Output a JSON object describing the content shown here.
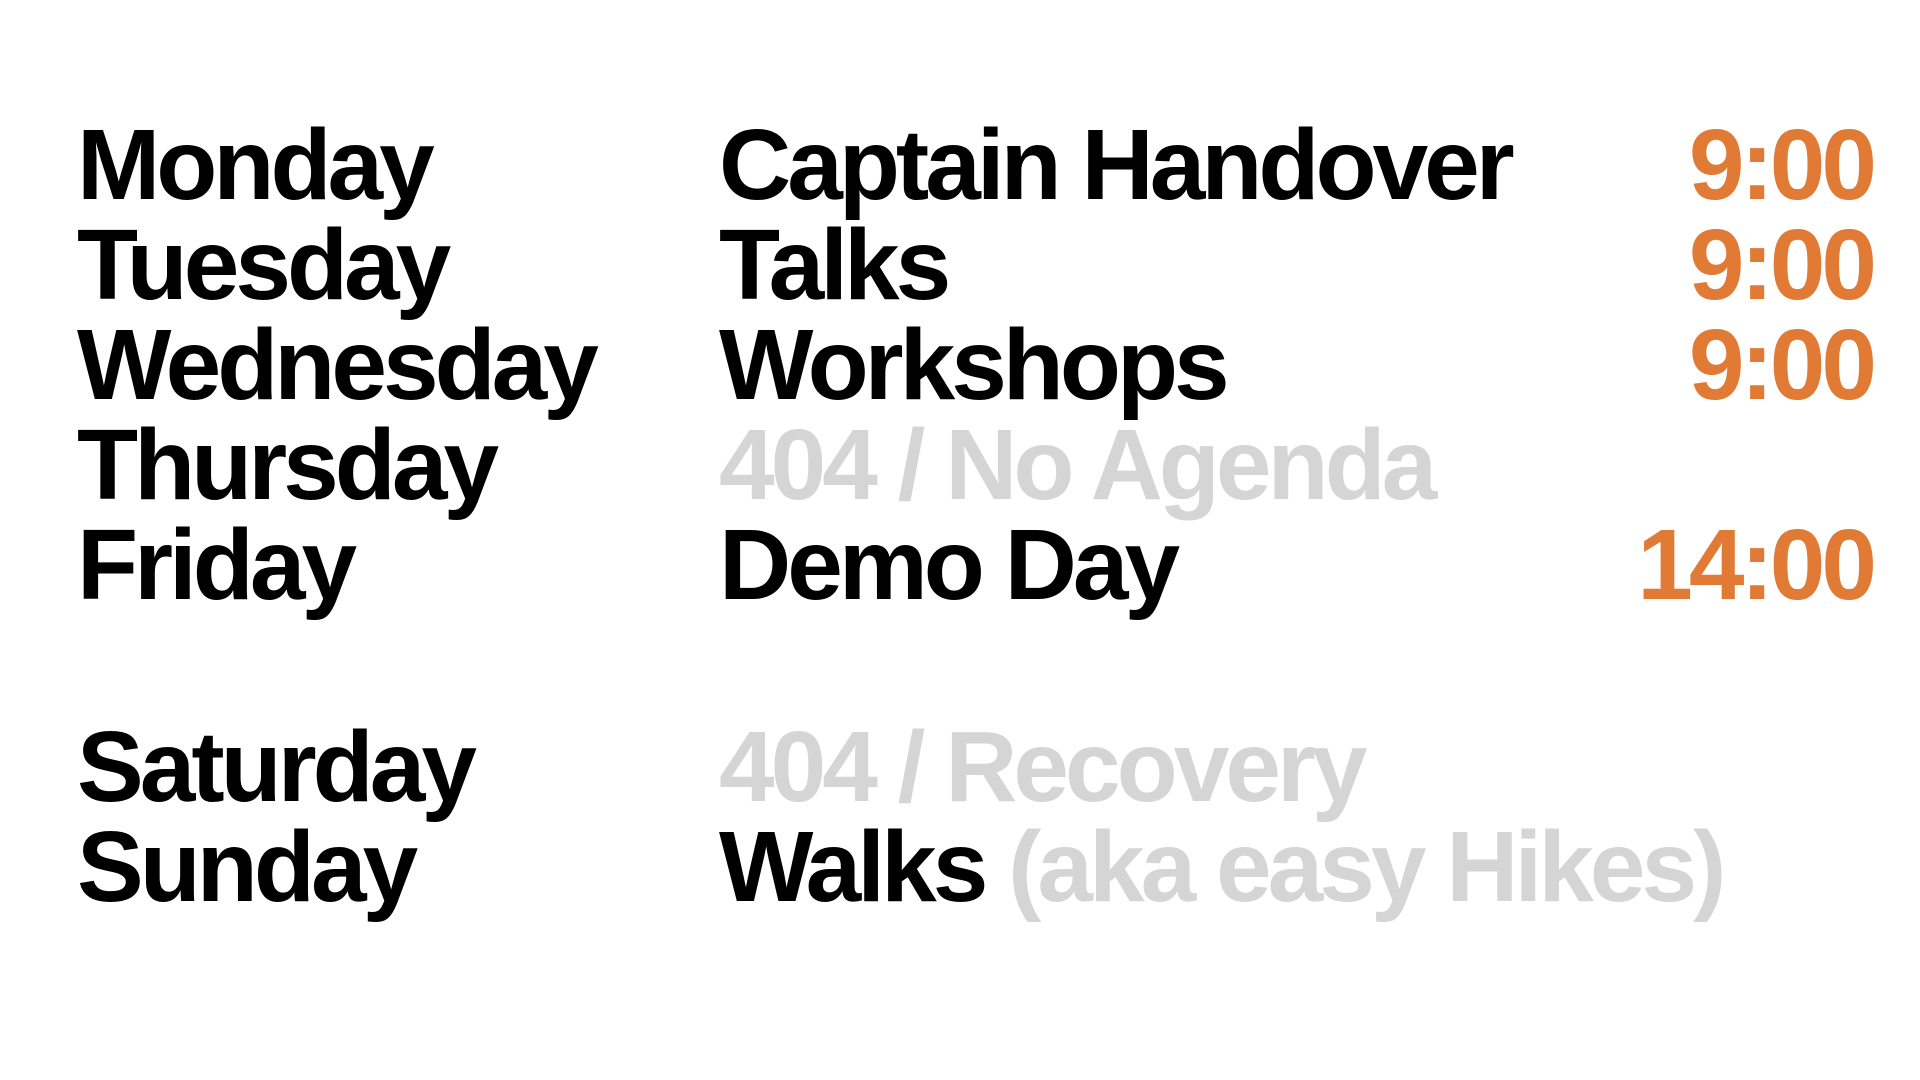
{
  "colors": {
    "background": "#ffffff",
    "text": "#000000",
    "muted": "#d5d5d5",
    "time": "#e07a34"
  },
  "schedule": [
    {
      "day": "Monday",
      "event": "Captain Handover",
      "note": "",
      "time": "9:00"
    },
    {
      "day": "Tuesday",
      "event": "Talks",
      "note": "",
      "time": "9:00"
    },
    {
      "day": "Wednesday",
      "event": "Workshops",
      "note": "",
      "time": "9:00"
    },
    {
      "day": "Thursday",
      "event": "404 / No Agenda",
      "note": "",
      "time": ""
    },
    {
      "day": "Friday",
      "event": "Demo Day",
      "note": "",
      "time": "14:00"
    },
    {
      "day": "Saturday",
      "event": "404 / Recovery",
      "note": "",
      "time": ""
    },
    {
      "day": "Sunday",
      "event": "Walks",
      "note": "(aka easy Hikes)",
      "time": ""
    }
  ]
}
